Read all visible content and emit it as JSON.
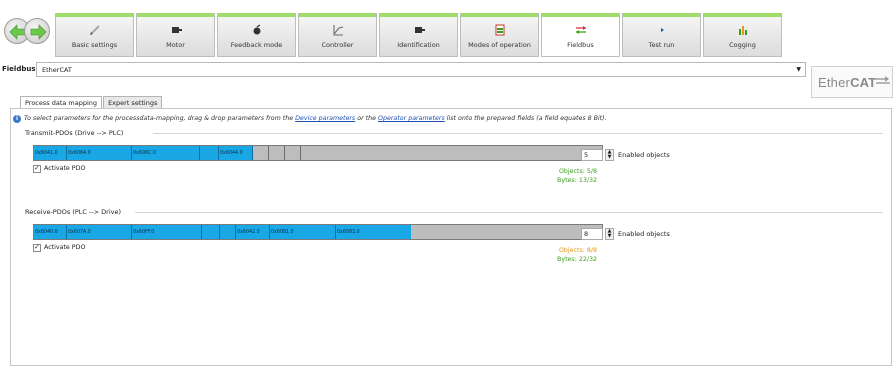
{
  "tabs": [
    {
      "label": "Basic settings",
      "icon": "pencil-icon",
      "active": false
    },
    {
      "label": "Motor",
      "icon": "motor-icon",
      "active": false
    },
    {
      "label": "Feedback mode",
      "icon": "feedback-icon",
      "active": false
    },
    {
      "label": "Controller",
      "icon": "controller-icon",
      "active": false
    },
    {
      "label": "Identification",
      "icon": "identification-icon",
      "active": false
    },
    {
      "label": "Modes of operation",
      "icon": "modes-icon",
      "active": false
    },
    {
      "label": "Fieldbus",
      "icon": "fieldbus-icon",
      "active": true
    },
    {
      "label": "Test run",
      "icon": "play-icon",
      "active": false
    },
    {
      "label": "Cogging",
      "icon": "cogging-icon",
      "active": false
    }
  ],
  "fieldbus": {
    "label": "Fieldbus:",
    "value": "EtherCAT"
  },
  "logo": {
    "text_plain": "Ether",
    "text_bold": "CAT"
  },
  "subtabs": {
    "process": "Process data mapping",
    "expert": "Expert settings"
  },
  "info": {
    "prefix": "To select parameters for the processdata-mapping, drag & drop parameters from the",
    "link1": "Device parameters",
    "middle": "or the",
    "link2": "Operator parameters",
    "suffix": "list onto the prepared fields (a field equates 8 Bit)."
  },
  "transmit": {
    "title": "Transmit-PDOs (Drive --> PLC)",
    "cells": [
      "0x6041.0",
      "0x6064.0",
      "0x606C.0",
      "",
      "0x6044.0",
      "",
      ""
    ],
    "activate_label": "Activate PDO",
    "enabled_value": "5",
    "enabled_label": "Enabled objects",
    "objects": "Objects: 5/8",
    "bytes": "Bytes: 13/32"
  },
  "receive": {
    "title": "Receive-PDOs (PLC --> Drive)",
    "cells": [
      "0x6040.0",
      "0x607A.0",
      "0x60FF.0",
      "",
      "",
      "0x6042.0",
      "0x6081.0",
      "0x6083.0"
    ],
    "activate_label": "Activate PDO",
    "enabled_value": "8",
    "enabled_label": "Enabled objects",
    "objects": "Objects: 8/8",
    "bytes": "Bytes: 22/32"
  },
  "colors": {
    "accent_green": "#9fdc6a",
    "pdo_blue": "#1aa7e6",
    "objects_orange": "#e39a17",
    "bytes_green": "#3d9e1c"
  }
}
